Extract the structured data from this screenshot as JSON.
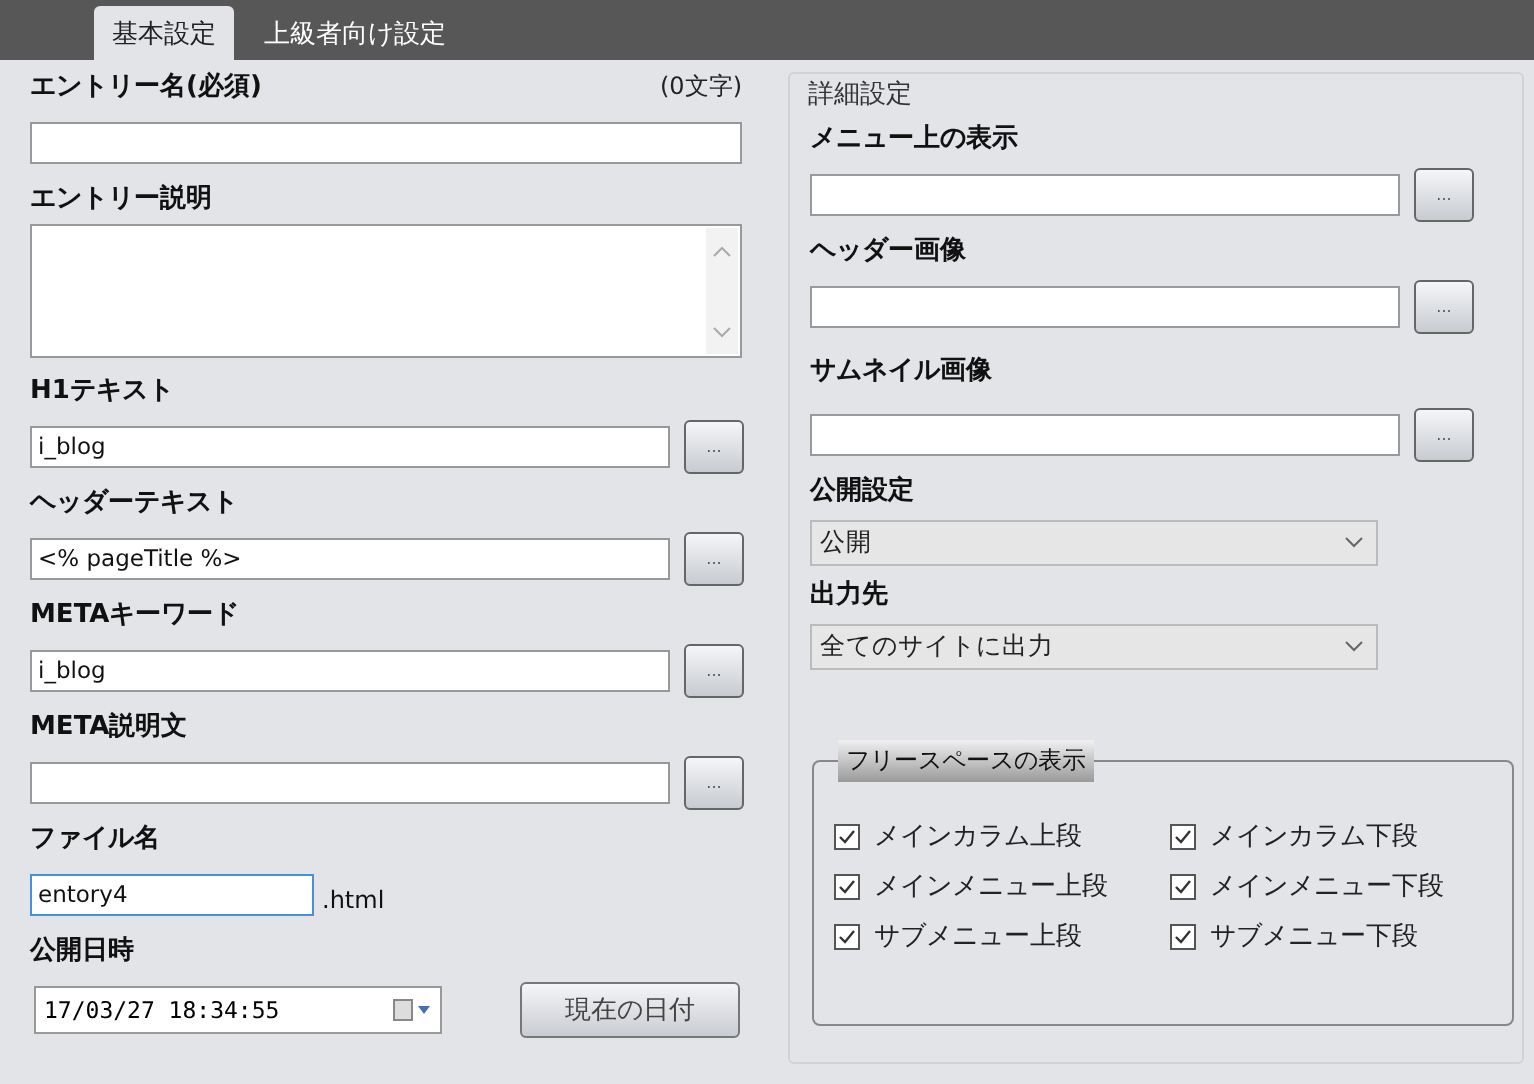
{
  "tabs": [
    {
      "label": "基本設定",
      "selected": true
    },
    {
      "label": "上級者向け設定",
      "selected": false
    }
  ],
  "left": {
    "entry_name": {
      "label": "エントリー名(必須)",
      "counter": "(0文字)"
    },
    "entry_description": {
      "label": "エントリー説明"
    },
    "fields": [
      {
        "label": "H1テキスト",
        "value": "i_blog",
        "button": "..."
      },
      {
        "label": "ヘッダーテキスト",
        "value": "<% pageTitle %>",
        "button": "..."
      },
      {
        "label": "METAキーワード",
        "value": "i_blog",
        "button": "..."
      },
      {
        "label": "META説明文",
        "button": "..."
      }
    ],
    "file_name": {
      "label": "ファイル名",
      "value": "entory4",
      "suffix": ".html",
      "focused": true
    },
    "publish_date": {
      "label": "公開日時",
      "value": "17/03/27 18:34:55",
      "button": "現在の日付"
    }
  },
  "right": {
    "title": "詳細設定",
    "fields": [
      {
        "kind": "browse",
        "label": "メニュー上の表示",
        "button": "..."
      },
      {
        "kind": "browse",
        "label": "ヘッダー画像",
        "button": "..."
      },
      {
        "kind": "browse",
        "label": "サムネイル画像",
        "button": "..."
      },
      {
        "kind": "select",
        "label": "公開設定",
        "value": "公開"
      },
      {
        "kind": "select",
        "label": "出力先",
        "value": "全てのサイトに出力"
      }
    ],
    "free_space": {
      "title": "フリースペースの表示",
      "options": [
        {
          "label": "メインカラム上段",
          "checked": true
        },
        {
          "label": "メインカラム下段",
          "checked": true
        },
        {
          "label": "メインメニュー上段",
          "checked": true
        },
        {
          "label": "メインメニュー下段",
          "checked": true
        },
        {
          "label": "サブメニュー上段",
          "checked": true
        },
        {
          "label": "サブメニュー下段",
          "checked": true
        }
      ]
    }
  }
}
